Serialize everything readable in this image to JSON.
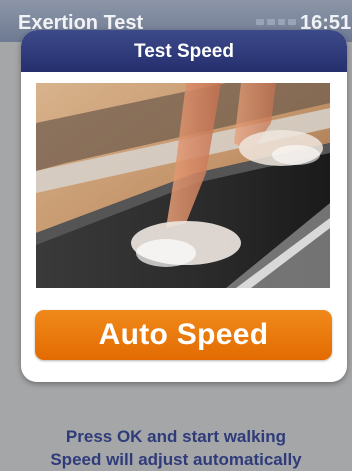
{
  "status_bar": {
    "title": "Exertion Test",
    "time": "16:51",
    "signal_icon": "signal-strength-icon"
  },
  "modal": {
    "title": "Test Speed",
    "image_icon": "treadmill-walking-photo",
    "auto_speed_label": "Auto Speed"
  },
  "instructions": {
    "line1": "Press OK and start walking",
    "line2": "Speed will adjust automatically"
  },
  "colors": {
    "header": "#2b3575",
    "button": "#e8770b",
    "instruction_text": "#2f3b7a",
    "background": "#a5a6a8"
  }
}
